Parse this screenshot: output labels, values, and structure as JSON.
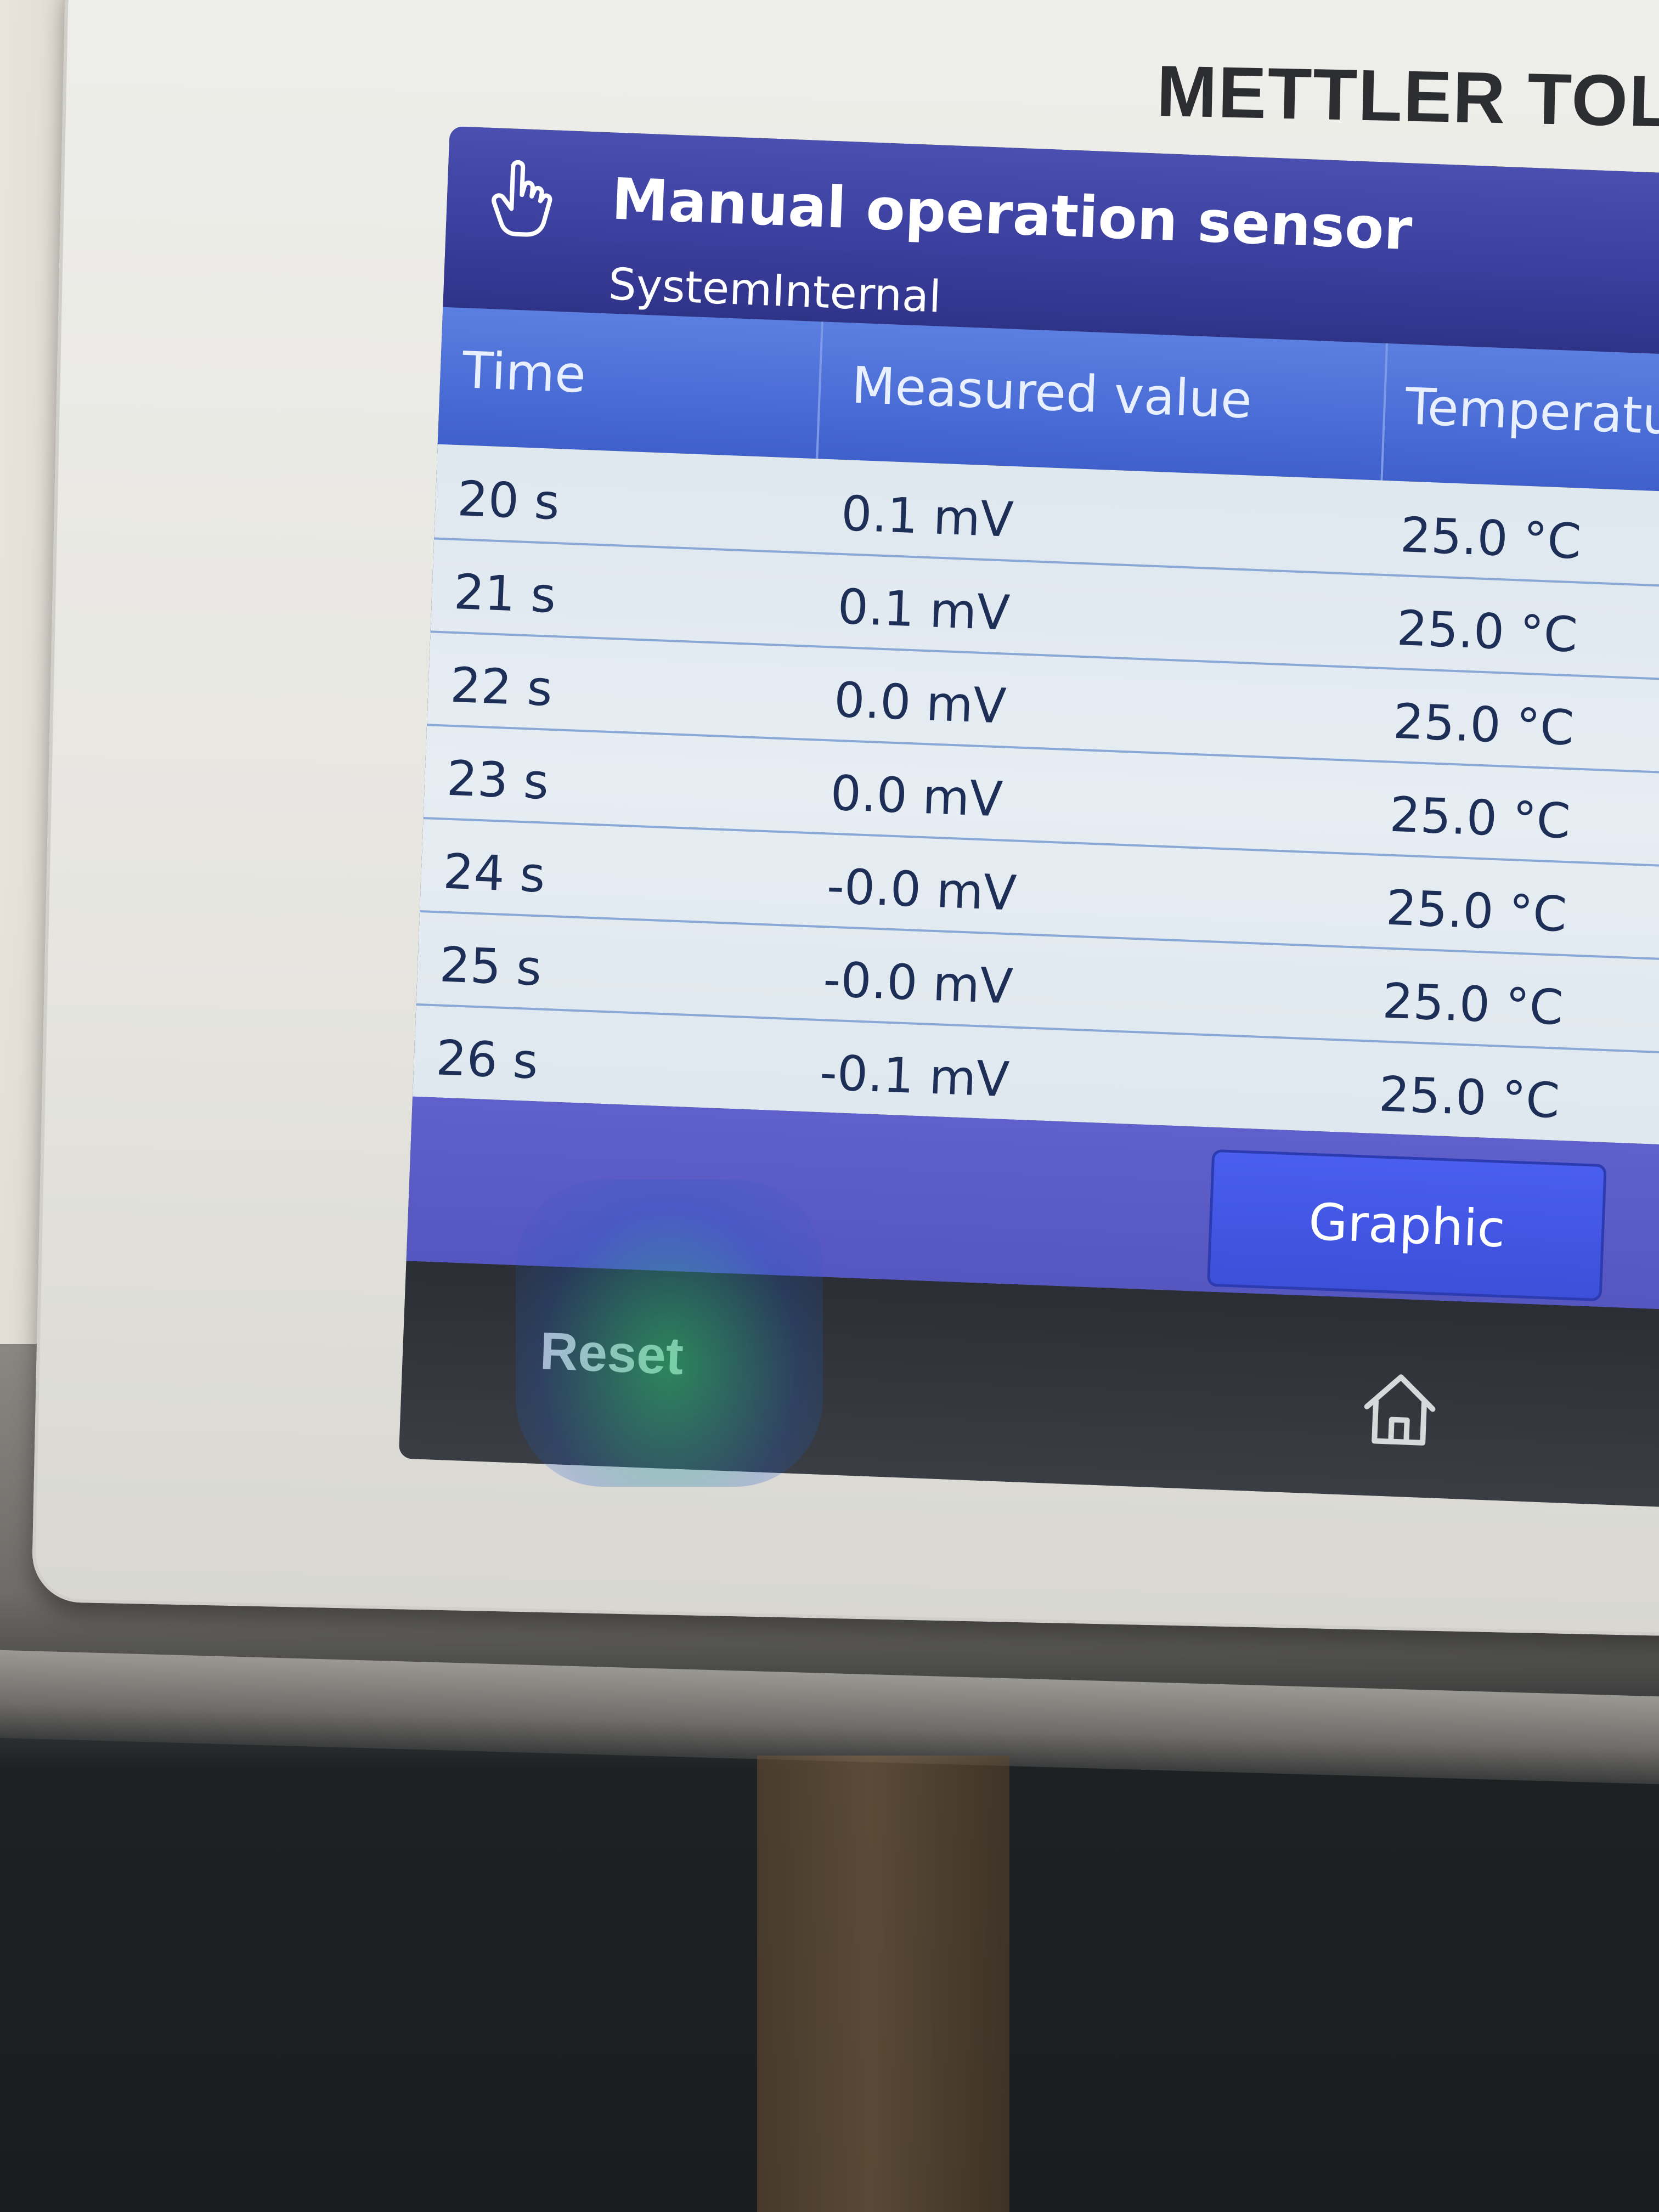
{
  "device": {
    "brand": "METTLER TOLEDO"
  },
  "header": {
    "icon": "hand-pointer-icon",
    "title": "Manual operation sensor",
    "subtitle": "SystemInternal"
  },
  "table": {
    "columns": [
      "Time",
      "Measured value",
      "Temperatu"
    ],
    "rows": [
      {
        "time": "20 s",
        "value": "0.1 mV",
        "temperature": "25.0 °C"
      },
      {
        "time": "21 s",
        "value": "0.1 mV",
        "temperature": "25.0 °C"
      },
      {
        "time": "22 s",
        "value": "0.0 mV",
        "temperature": "25.0 °C"
      },
      {
        "time": "23 s",
        "value": "0.0 mV",
        "temperature": "25.0 °C"
      },
      {
        "time": "24 s",
        "value": "-0.0 mV",
        "temperature": "25.0 °C"
      },
      {
        "time": "25 s",
        "value": "-0.0 mV",
        "temperature": "25.0 °C"
      },
      {
        "time": "26 s",
        "value": "-0.1 mV",
        "temperature": "25.0 °C"
      }
    ]
  },
  "actions": {
    "graphic_label": "Graphic"
  },
  "footer": {
    "reset_label": "Reset",
    "home_icon": "home-icon"
  },
  "colors": {
    "header_bg": "#3b3f9e",
    "table_header_bg": "#4a6cd6",
    "row_bg": "#e3eaf1",
    "row_text": "#1d2e57",
    "button_bg": "#3c4fd8",
    "footer_bg": "#2b2f35"
  }
}
